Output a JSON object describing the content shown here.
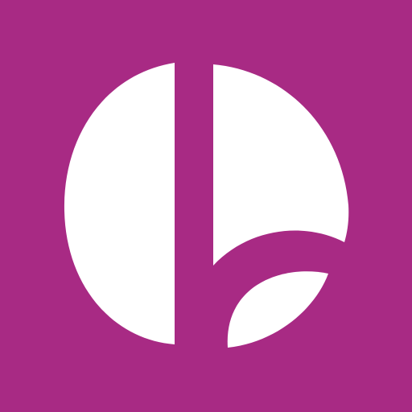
{
  "icon": {
    "name": "logo-icon",
    "background_color": "#a82a84",
    "foreground_color": "#ffffff"
  }
}
